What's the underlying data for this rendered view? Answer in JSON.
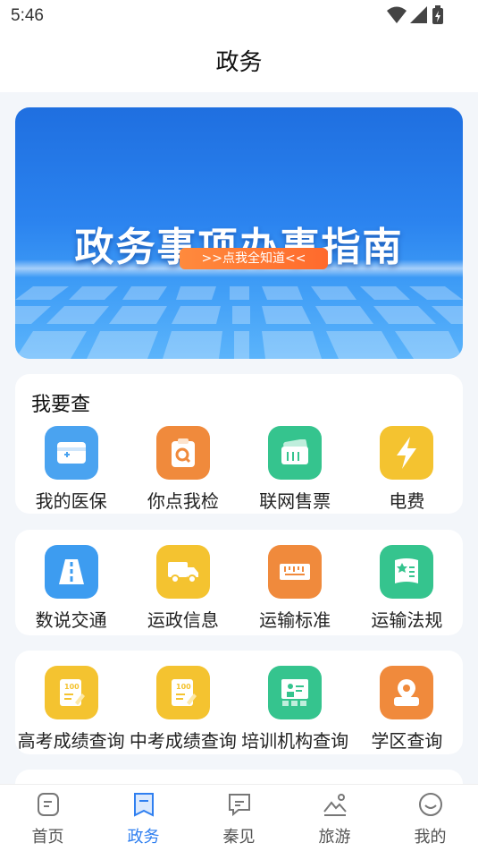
{
  "status_bar": {
    "time": "5:46"
  },
  "header": {
    "title": "政务"
  },
  "banner": {
    "title": "政务事项办事指南",
    "pill": ">>点我全知道<<"
  },
  "sections": [
    {
      "title": "我要查",
      "items": [
        {
          "label": "我的医保",
          "icon": "medical-card-icon",
          "color": "#4aa3f0"
        },
        {
          "label": "你点我检",
          "icon": "clipboard-search-icon",
          "color": "#f08a3c"
        },
        {
          "label": "联网售票",
          "icon": "ticket-icon",
          "color": "#35c48e"
        },
        {
          "label": "电费",
          "icon": "lightning-icon",
          "color": "#f4c330"
        }
      ]
    },
    {
      "title": "",
      "items": [
        {
          "label": "数说交通",
          "icon": "road-icon",
          "color": "#3d9cf0"
        },
        {
          "label": "运政信息",
          "icon": "truck-icon",
          "color": "#f4c330"
        },
        {
          "label": "运输标准",
          "icon": "ruler-icon",
          "color": "#f08a3c"
        },
        {
          "label": "运输法规",
          "icon": "book-icon",
          "color": "#35c48e"
        }
      ]
    },
    {
      "title": "",
      "items": [
        {
          "label": "高考成绩查询",
          "icon": "exam-score-icon",
          "color": "#f4c330"
        },
        {
          "label": "中考成绩查询",
          "icon": "exam-score-icon",
          "color": "#f4c330"
        },
        {
          "label": "培训机构查询",
          "icon": "training-board-icon",
          "color": "#35c48e"
        },
        {
          "label": "学区查询",
          "icon": "location-pin-icon",
          "color": "#f08a3c"
        }
      ]
    }
  ],
  "tabs": [
    {
      "label": "首页",
      "icon": "home-doc-icon",
      "active": false
    },
    {
      "label": "政务",
      "icon": "bookmark-icon",
      "active": true
    },
    {
      "label": "秦见",
      "icon": "chat-icon",
      "active": false
    },
    {
      "label": "旅游",
      "icon": "landscape-icon",
      "active": false
    },
    {
      "label": "我的",
      "icon": "smile-icon",
      "active": false
    }
  ],
  "colors": {
    "accent": "#2f7ff0",
    "inactive": "#555555",
    "background": "#f3f6fa"
  }
}
